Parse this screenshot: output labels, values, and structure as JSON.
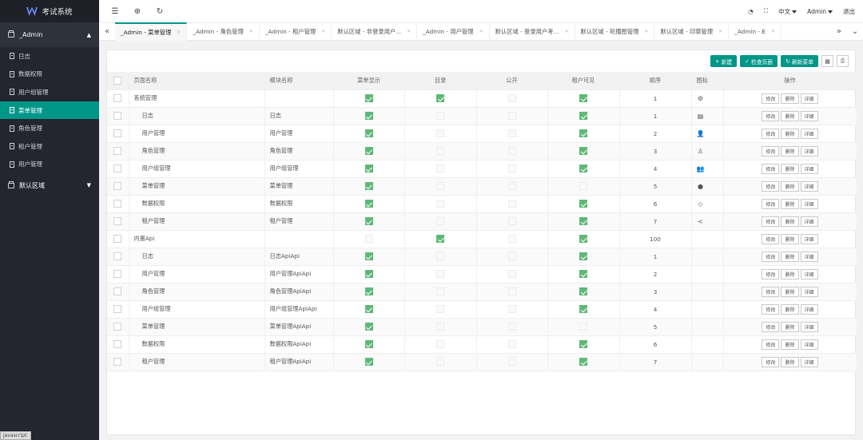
{
  "app": {
    "title": "考试系统",
    "status_text": "javascript:"
  },
  "sidebar": {
    "group_label": "_Admin",
    "items": [
      {
        "label": "日志",
        "active": false
      },
      {
        "label": "数据权限",
        "active": false
      },
      {
        "label": "用户组管理",
        "active": false
      },
      {
        "label": "菜单管理",
        "active": true
      },
      {
        "label": "角色管理",
        "active": false
      },
      {
        "label": "租户管理",
        "active": false
      },
      {
        "label": "用户管理",
        "active": false
      }
    ],
    "group2_label": "默认区域"
  },
  "topbar": {
    "lang": "中文",
    "user": "Admin",
    "logout": "退出"
  },
  "tabs": [
    {
      "label": "_Admin - 菜单管理",
      "active": true
    },
    {
      "label": "_Admin - 角色管理",
      "active": false
    },
    {
      "label": "_Admin - 租户管理",
      "active": false
    },
    {
      "label": "默认区域 - 非登录用户...",
      "active": false
    },
    {
      "label": "_Admin - 用户管理",
      "active": false
    },
    {
      "label": "默认区域 - 登录用户考...",
      "active": false
    },
    {
      "label": "默认区域 - 轮播图管理",
      "active": false
    },
    {
      "label": "默认区域 - 印章管理",
      "active": false
    },
    {
      "label": "_Admin - E",
      "active": false
    }
  ],
  "toolbar": {
    "create": "新建",
    "check": "检查页面",
    "refresh": "刷新菜单"
  },
  "table": {
    "headers": [
      "页面名称",
      "模块名称",
      "菜单显示",
      "目录",
      "公开",
      "租户可见",
      "顺序",
      "图标",
      "操作"
    ],
    "actions": [
      "修改",
      "删除",
      "详细"
    ],
    "rows": [
      {
        "name": "系统管理",
        "module": "",
        "show": true,
        "dir": true,
        "pub": false,
        "tenant": true,
        "order": "1",
        "icon": "⚙",
        "sub": false
      },
      {
        "name": "日志",
        "module": "日志",
        "show": true,
        "dir": false,
        "pub": false,
        "tenant": true,
        "order": "1",
        "icon": "▤",
        "sub": true
      },
      {
        "name": "用户管理",
        "module": "用户管理",
        "show": true,
        "dir": false,
        "pub": false,
        "tenant": true,
        "order": "2",
        "icon": "👤",
        "sub": true
      },
      {
        "name": "角色管理",
        "module": "角色管理",
        "show": true,
        "dir": false,
        "pub": false,
        "tenant": true,
        "order": "3",
        "icon": "♙",
        "sub": true
      },
      {
        "name": "用户组管理",
        "module": "用户组管理",
        "show": true,
        "dir": false,
        "pub": false,
        "tenant": true,
        "order": "4",
        "icon": "👥",
        "sub": true
      },
      {
        "name": "菜单管理",
        "module": "菜单管理",
        "show": true,
        "dir": false,
        "pub": false,
        "tenant": false,
        "order": "5",
        "icon": "●",
        "sub": true
      },
      {
        "name": "数据权限",
        "module": "数据权限",
        "show": true,
        "dir": false,
        "pub": false,
        "tenant": true,
        "order": "6",
        "icon": "◇",
        "sub": true
      },
      {
        "name": "租户管理",
        "module": "租户管理",
        "show": true,
        "dir": false,
        "pub": false,
        "tenant": true,
        "order": "7",
        "icon": "<",
        "sub": true
      },
      {
        "name": "内置Api",
        "module": "",
        "show": false,
        "dir": true,
        "pub": false,
        "tenant": true,
        "order": "100",
        "icon": "",
        "sub": false
      },
      {
        "name": "日志",
        "module": "日志ApiApi",
        "show": true,
        "dir": false,
        "pub": false,
        "tenant": true,
        "order": "1",
        "icon": "",
        "sub": true
      },
      {
        "name": "用户管理",
        "module": "用户管理ApiApi",
        "show": true,
        "dir": false,
        "pub": false,
        "tenant": true,
        "order": "2",
        "icon": "",
        "sub": true
      },
      {
        "name": "角色管理",
        "module": "角色管理ApiApi",
        "show": true,
        "dir": false,
        "pub": false,
        "tenant": true,
        "order": "3",
        "icon": "",
        "sub": true
      },
      {
        "name": "用户组管理",
        "module": "用户组管理ApiApi",
        "show": true,
        "dir": false,
        "pub": false,
        "tenant": true,
        "order": "4",
        "icon": "",
        "sub": true
      },
      {
        "name": "菜单管理",
        "module": "菜单管理ApiApi",
        "show": true,
        "dir": false,
        "pub": false,
        "tenant": false,
        "order": "5",
        "icon": "",
        "sub": true
      },
      {
        "name": "数据权限",
        "module": "数据权限ApiApi",
        "show": true,
        "dir": false,
        "pub": false,
        "tenant": true,
        "order": "6",
        "icon": "",
        "sub": true
      },
      {
        "name": "租户管理",
        "module": "租户管理ApiApi",
        "show": true,
        "dir": false,
        "pub": false,
        "tenant": true,
        "order": "7",
        "icon": "",
        "sub": true
      }
    ]
  }
}
